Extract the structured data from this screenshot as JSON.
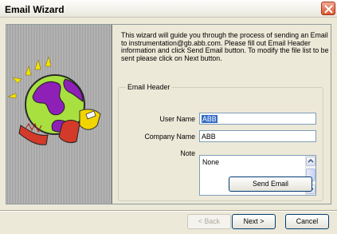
{
  "window": {
    "title": "Email Wizard"
  },
  "intro_text": "This wizard will guide you through the process of sending an Email to instrumentation@gb.abb.com. Please fill out Email Header information and click Send Email button. To modify the file list to be sent please click on Next button.",
  "email_header": {
    "legend": "Email Header",
    "user_name_label": "User Name",
    "user_name_value": "ABB",
    "company_name_label": "Company Name",
    "company_name_value": "ABB",
    "note_label": "Note",
    "note_value": "None",
    "send_label": "Send Email"
  },
  "footer": {
    "back_label": "< Back",
    "next_label": "Next >",
    "cancel_label": "Cancel"
  },
  "colors": {
    "selection": "#316ac5",
    "title_close": "#d9572f"
  }
}
